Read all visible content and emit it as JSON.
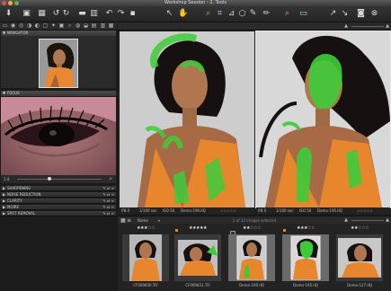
{
  "window": {
    "title": "Workshop Session - 2. Tools"
  },
  "toolbar": {
    "icons": [
      "import-icon",
      "capture-icon",
      "grid-icon",
      "rotate-left-icon",
      "rotate-right-icon",
      "folder-icon",
      "delete-icon",
      "undo-icon",
      "redo-icon",
      "cursor-tool-icon",
      "pan-tool-icon",
      "zoom-tool-icon",
      "crop-tool-icon",
      "straighten-tool-icon",
      "keystone-tool-icon",
      "spot-removal-tool-icon",
      "wb-picker-icon",
      "annotate-tool-icon",
      "loupe-icon",
      "edit-icon",
      "copy-apply-icon",
      "camera-icon",
      "exposure-warning-icon",
      "grid-overlay-icon"
    ]
  },
  "left_panel": {
    "navigator_label": "NAVIGATOR",
    "focus_label": "FOCUS",
    "focus_zoom": "1:4",
    "tools": [
      {
        "label": "SHARPENING"
      },
      {
        "label": "NOISE REDUCTION"
      },
      {
        "label": "CLARITY"
      },
      {
        "label": "MOIRE"
      },
      {
        "label": "SPOT REMOVAL"
      }
    ]
  },
  "viewer": {
    "left": {
      "exposure": "f/8.0",
      "shutter": "1/100 sec",
      "iso": "ISO 50",
      "filename": "Demo-190.IIQ"
    },
    "right": {
      "exposure": "f/8.0",
      "shutter": "1/100 sec",
      "iso": "ISO 50",
      "filename": "Demo-195.IIQ"
    },
    "mask_color": "#3ecb3a"
  },
  "browser": {
    "sort_label": "Name",
    "count_label": "2 of 32 images selected",
    "thumbs": [
      {
        "stars": 3,
        "file": "CF009830.TIF",
        "selected": false,
        "tag": false
      },
      {
        "stars": 5,
        "file": "CF009831.TIF",
        "selected": false,
        "tag": true
      },
      {
        "stars": 2,
        "file": "Demo-190.IIQ",
        "selected": true,
        "tag": false
      },
      {
        "stars": 3,
        "file": "Demo-195.IIQ",
        "selected": true,
        "tag": true
      },
      {
        "stars": 2,
        "file": "Demo-127.IIQ",
        "selected": false,
        "tag": false
      }
    ]
  }
}
